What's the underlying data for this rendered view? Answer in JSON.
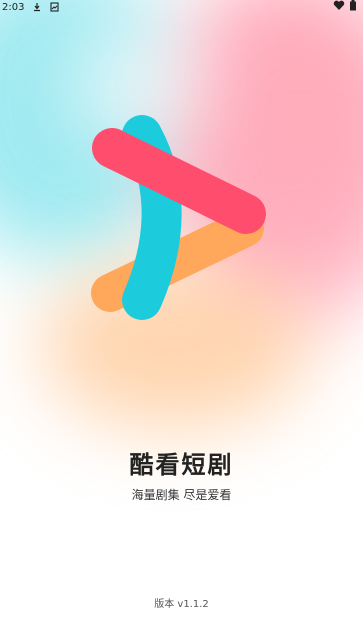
{
  "status_bar": {
    "time": "2:03",
    "icons": [
      "download-icon",
      "image-icon",
      "heart-icon",
      "battery-icon"
    ]
  },
  "splash": {
    "app_name": "酷看短剧",
    "slogan": "海量剧集 尽是爱看",
    "version": "版本 v1.1.2"
  },
  "logo": {
    "colors": {
      "cyan": "#1ccbdc",
      "pink": "#ff4d6d",
      "orange": "#ffa75a"
    }
  }
}
